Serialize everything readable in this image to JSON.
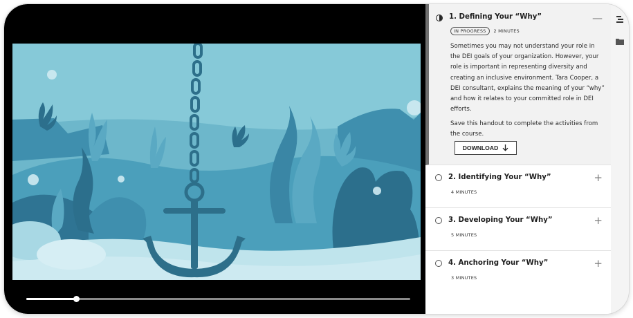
{
  "player": {
    "progress_percent": 13
  },
  "outline": {
    "sections": [
      {
        "title": "1. Defining Your “Why”",
        "status_badge": "IN PROGRESS",
        "duration": "2 MINUTES",
        "description": "Sometimes you may not understand your role in the DEI goals of your organization. However, your role is important in representing diversity and creating an inclusive environment. Tara Cooper, a DEI consultant, explains the meaning of your “why” and how it relates to your committed role in DEI efforts.",
        "note": "Save this handout to complete the activities from the course.",
        "download_label": "DOWNLOAD",
        "toggle": "—",
        "state": "in-progress"
      },
      {
        "title": "2. Identifying Your “Why”",
        "duration": "4 MINUTES",
        "toggle": "+",
        "state": "not-started"
      },
      {
        "title": "3. Developing Your “Why”",
        "duration": "5 MINUTES",
        "toggle": "+",
        "state": "not-started"
      },
      {
        "title": "4. Anchoring Your “Why”",
        "duration": "3 MINUTES",
        "toggle": "+",
        "state": "not-started"
      }
    ]
  },
  "rail": {
    "icons": [
      "outline-icon",
      "folder-icon"
    ]
  },
  "colors": {
    "ocean_light": "#7fc3d4",
    "ocean_mid": "#3f97b3",
    "ocean_dark": "#2d6f8a",
    "sand": "#bfe4ec",
    "player_background": "#000000",
    "active_section_bg": "#f2f2f2"
  }
}
